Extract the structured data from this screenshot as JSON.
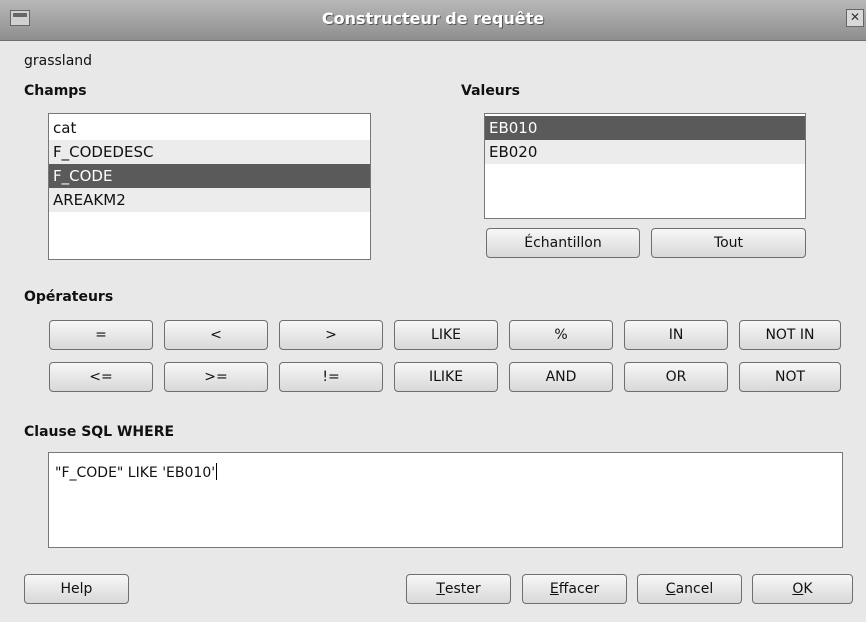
{
  "window": {
    "title": "Constructeur de requête"
  },
  "layer_name": "grassland",
  "fields": {
    "title": "Champs",
    "items": [
      "cat",
      "F_CODEDESC",
      "F_CODE",
      "AREAKM2"
    ]
  },
  "values": {
    "title": "Valeurs",
    "items": [
      "EB010",
      "EB020"
    ],
    "sample_label": "Échantillon",
    "all_label": "Tout"
  },
  "operators": {
    "title": "Opérateurs",
    "row1": [
      "=",
      "<",
      ">",
      "LIKE",
      "%",
      "IN",
      "NOT IN"
    ],
    "row2": [
      "<=",
      ">=",
      "!=",
      "ILIKE",
      "AND",
      "OR",
      "NOT"
    ]
  },
  "where": {
    "title": "Clause SQL WHERE",
    "value": "\"F_CODE\" LIKE 'EB010'"
  },
  "footer": {
    "help": "Help",
    "test_first": "T",
    "test_rest": "ester",
    "clear_first": "E",
    "clear_rest": "ffacer",
    "cancel_first": "C",
    "cancel_rest": "ancel",
    "ok_first": "O",
    "ok_rest": "K"
  }
}
